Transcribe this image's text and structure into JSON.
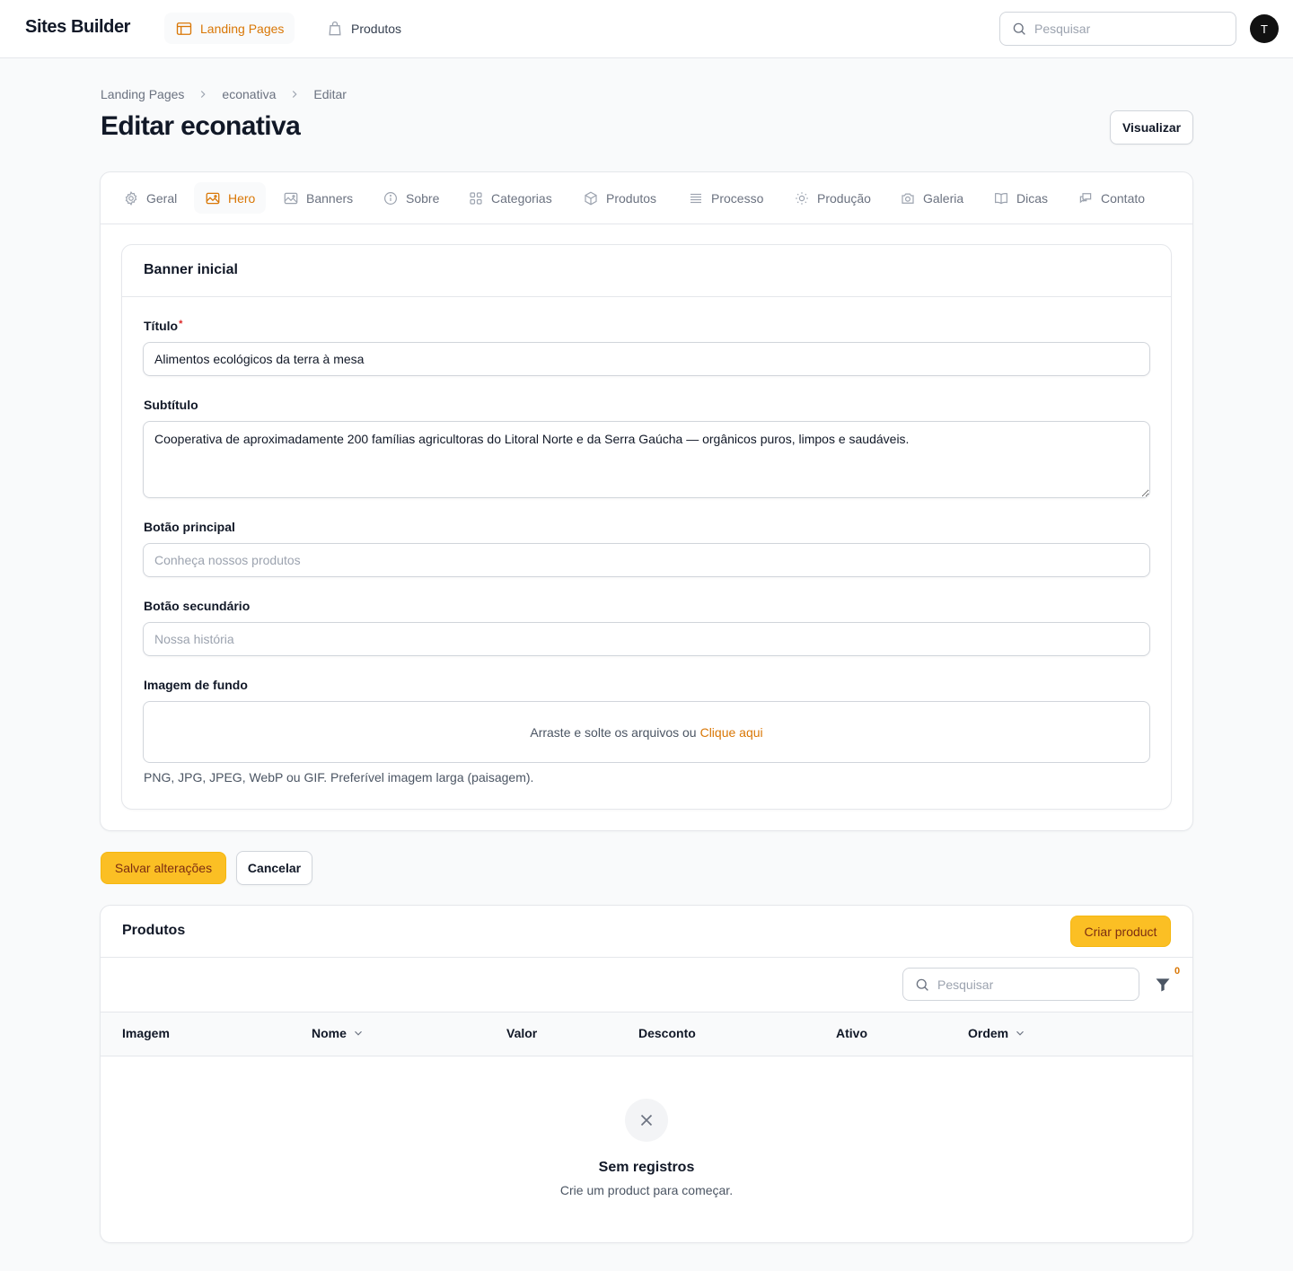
{
  "app": {
    "brand": "Sites Builder",
    "avatar_initial": "T"
  },
  "topnav": {
    "items": [
      {
        "label": "Landing Pages",
        "icon": "browser-window-icon",
        "active": true
      },
      {
        "label": "Produtos",
        "icon": "shopping-bag-icon",
        "active": false
      }
    ],
    "search_placeholder": "Pesquisar"
  },
  "breadcrumb": [
    "Landing Pages",
    "econativa",
    "Editar"
  ],
  "page": {
    "title": "Editar econativa",
    "preview_label": "Visualizar"
  },
  "tabs": [
    {
      "label": "Geral",
      "icon": "gear-icon"
    },
    {
      "label": "Hero",
      "icon": "image-icon",
      "active": true
    },
    {
      "label": "Banners",
      "icon": "image-icon"
    },
    {
      "label": "Sobre",
      "icon": "info-circle-icon"
    },
    {
      "label": "Categorias",
      "icon": "grid-icon"
    },
    {
      "label": "Produtos",
      "icon": "cube-icon"
    },
    {
      "label": "Processo",
      "icon": "list-icon"
    },
    {
      "label": "Produção",
      "icon": "sun-icon"
    },
    {
      "label": "Galeria",
      "icon": "camera-icon"
    },
    {
      "label": "Dicas",
      "icon": "book-icon"
    },
    {
      "label": "Contato",
      "icon": "chat-icon"
    }
  ],
  "hero_section": {
    "heading": "Banner inicial",
    "title_label": "Título",
    "required_mark": "*",
    "title_value": "Alimentos ecológicos da terra à mesa",
    "subtitle_label": "Subtítulo",
    "subtitle_value": "Cooperativa de aproximadamente 200 famílias agricultoras do Litoral Norte e da Serra Gaúcha — orgânicos puros, limpos e saudáveis.",
    "primary_button_label": "Botão principal",
    "primary_button_placeholder": "Conheça nossos produtos",
    "secondary_button_label": "Botão secundário",
    "secondary_button_placeholder": "Nossa história",
    "background_label": "Imagem de fundo",
    "dropzone_text": "Arraste e solte os arquivos ou",
    "dropzone_link": "Clique aqui",
    "background_hint": "PNG, JPG, JPEG, WebP ou GIF. Preferível imagem larga (paisagem)."
  },
  "form_actions": {
    "save_label": "Salvar alterações",
    "cancel_label": "Cancelar"
  },
  "products": {
    "title": "Produtos",
    "create_label": "Criar product",
    "search_placeholder": "Pesquisar",
    "filter_count": "0",
    "columns": [
      {
        "label": "Imagem",
        "sortable": false
      },
      {
        "label": "Nome",
        "sortable": true
      },
      {
        "label": "Valor",
        "sortable": false
      },
      {
        "label": "Desconto",
        "sortable": false
      },
      {
        "label": "Ativo",
        "sortable": false
      },
      {
        "label": "Ordem",
        "sortable": true
      }
    ],
    "empty_title": "Sem registros",
    "empty_description": "Crie um product para começar."
  },
  "colors": {
    "accent": "#d97706",
    "primary_button": "#fbbf24",
    "background": "#f9fafb"
  }
}
